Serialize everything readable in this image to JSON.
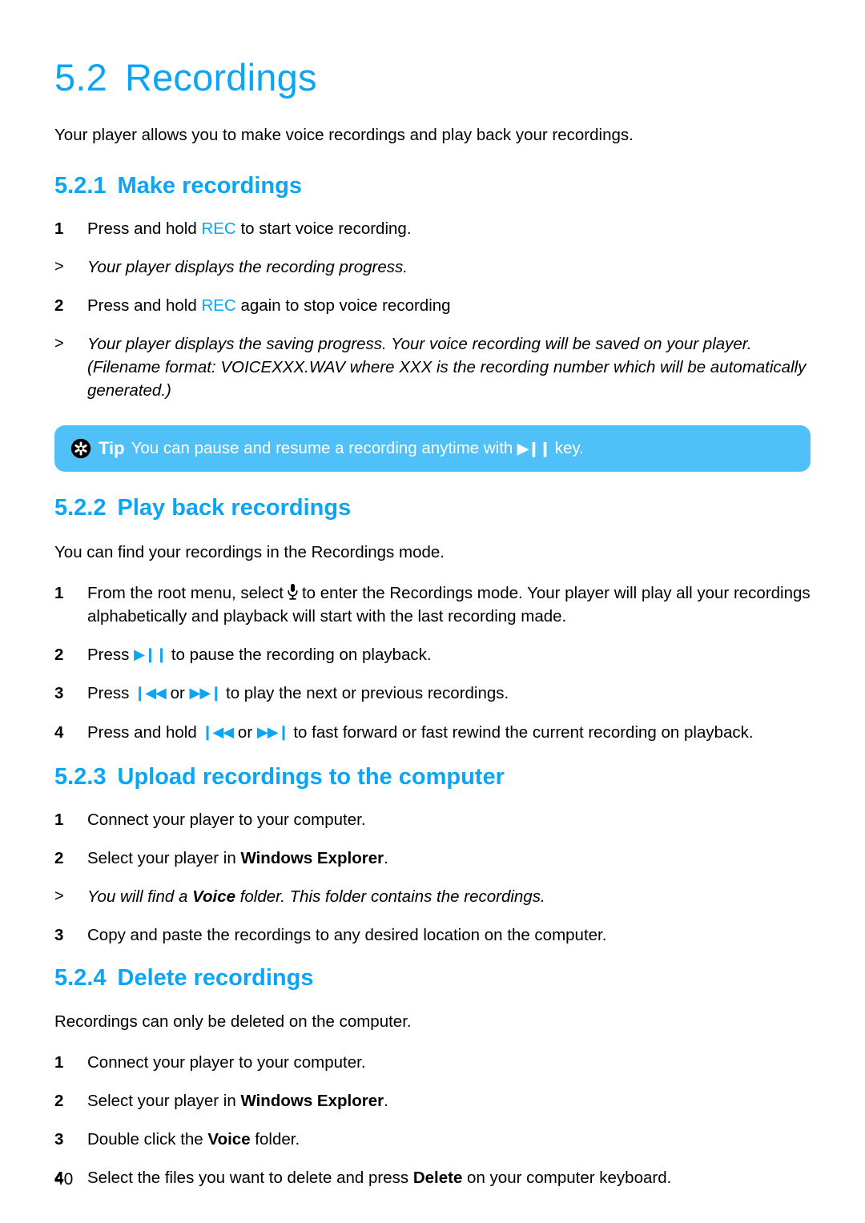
{
  "document": {
    "page_number": "40",
    "accent_color": "#0ca5f5",
    "tip_background_color": "#4fc0f8"
  },
  "title": {
    "number": "5.2",
    "text": "Recordings"
  },
  "intro": "Your player allows you to make voice recordings and play back your recordings.",
  "sections": [
    {
      "number": "5.2.1",
      "heading": "Make recordings",
      "steps": {
        "s1_marker": "1",
        "s1_a": "Press and hold ",
        "s1_key": "REC",
        "s1_b": " to start voice recording.",
        "n1_marker": ">",
        "n1": "Your player displays the recording progress.",
        "s2_marker": "2",
        "s2_a": "Press and hold ",
        "s2_key": "REC",
        "s2_b": " again to stop voice recording",
        "n2_marker": ">",
        "n2": "Your player displays the saving progress. Your voice recording will be saved on your player. (Filename format: VOICEXXX.WAV where XXX is the recording number which will be automatically generated.)"
      }
    },
    {
      "number": "5.2.2",
      "heading": "Play back recordings",
      "lead": "You can find your recordings in the Recordings mode.",
      "steps": {
        "s1_marker": "1",
        "s1_a": "From the root menu, select",
        "s1_icon": "microphone-icon",
        "s1_b": "to enter the Recordings mode. Your player will play all your recordings alphabetically and playback will start with the last recording made.",
        "s2_marker": "2",
        "s2_a": "Press ",
        "s2_glyph": "▶❙❙",
        "s2_b": " to pause the recording on playback.",
        "s3_marker": "3",
        "s3_a": "Press ",
        "s3_glyph1": "❙◀◀",
        "s3_mid": " or ",
        "s3_glyph2": "▶▶❙",
        "s3_b": " to play the next or previous recordings.",
        "s4_marker": "4",
        "s4_a": "Press and hold ",
        "s4_glyph1": "❙◀◀",
        "s4_mid": " or ",
        "s4_glyph2": "▶▶❙",
        "s4_b": " to fast forward or fast rewind the current recording on playback."
      }
    },
    {
      "number": "5.2.3",
      "heading": "Upload recordings to the computer",
      "steps": {
        "s1_marker": "1",
        "s1": "Connect your player to your computer.",
        "s2_marker": "2",
        "s2_a": "Select your player in ",
        "s2_bold": "Windows Explorer",
        "s2_b": ".",
        "n1_marker": ">",
        "n1_a": "You will find a ",
        "n1_bold": "Voice",
        "n1_b": " folder. This folder contains the recordings.",
        "s3_marker": "3",
        "s3": "Copy and paste the recordings to any desired location on the computer."
      }
    },
    {
      "number": "5.2.4",
      "heading": "Delete recordings",
      "lead": "Recordings can only be deleted on the computer.",
      "steps": {
        "s1_marker": "1",
        "s1": "Connect your player to your computer.",
        "s2_marker": "2",
        "s2_a": "Select your player in ",
        "s2_bold": "Windows Explorer",
        "s2_b": ".",
        "s3_marker": "3",
        "s3_a": "Double click the ",
        "s3_bold": "Voice",
        "s3_b": " folder.",
        "s4_marker": "4",
        "s4_a": "Select the files you want to delete and press ",
        "s4_bold": "Delete",
        "s4_b": " on your computer keyboard."
      }
    }
  ],
  "tip": {
    "icon": "asterisk-badge-icon",
    "label": "Tip",
    "text_a": "You can pause and resume a recording anytime with ",
    "glyph": "▶❙❙",
    "text_b": " key."
  }
}
